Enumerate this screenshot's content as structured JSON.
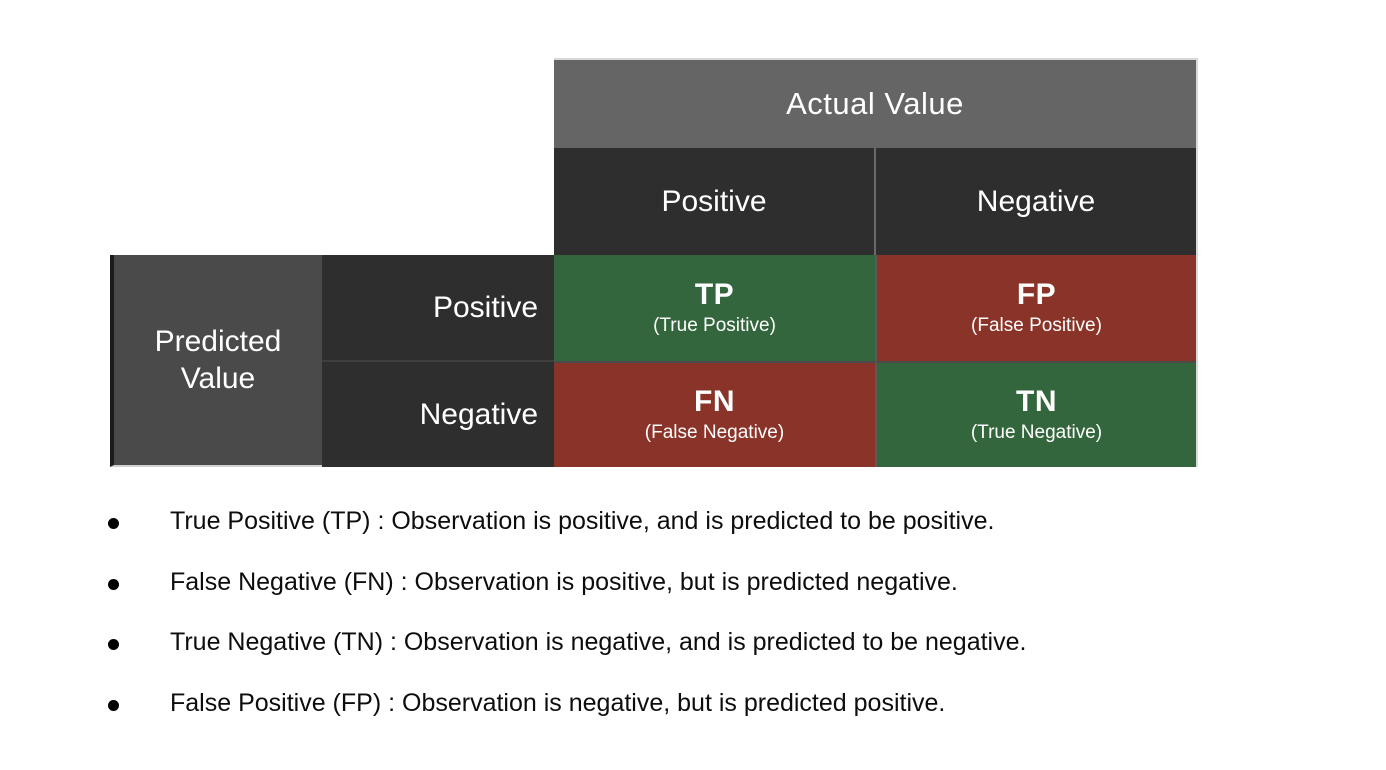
{
  "figure": {
    "column_header": {
      "title": "Actual Value",
      "columns": [
        "Positive",
        "Negative"
      ]
    },
    "row_header": {
      "title": "Predicted Value",
      "rows": [
        "Positive",
        "Negative"
      ]
    },
    "cells": [
      {
        "abbr": "TP",
        "full": "(True Positive)",
        "tone": "green"
      },
      {
        "abbr": "FP",
        "full": "(False Positive)",
        "tone": "red"
      },
      {
        "abbr": "FN",
        "full": "(False Negative)",
        "tone": "red"
      },
      {
        "abbr": "TN",
        "full": "(True Negative)",
        "tone": "green"
      }
    ],
    "colors": {
      "correct": "#33663C",
      "incorrect": "#8A3429",
      "header_gray": "#656565",
      "subheader_dark": "#2e2e2e",
      "row_header_gray": "#4a4a4a",
      "text": "#ffffff"
    }
  },
  "definitions": [
    "True Positive (TP) : Observation is positive, and is predicted to be positive.",
    "False Negative (FN) : Observation is positive, but is predicted negative.",
    "True Negative (TN) : Observation is negative, and is predicted to be negative.",
    "False Positive (FP) : Observation is negative, but is predicted positive."
  ]
}
